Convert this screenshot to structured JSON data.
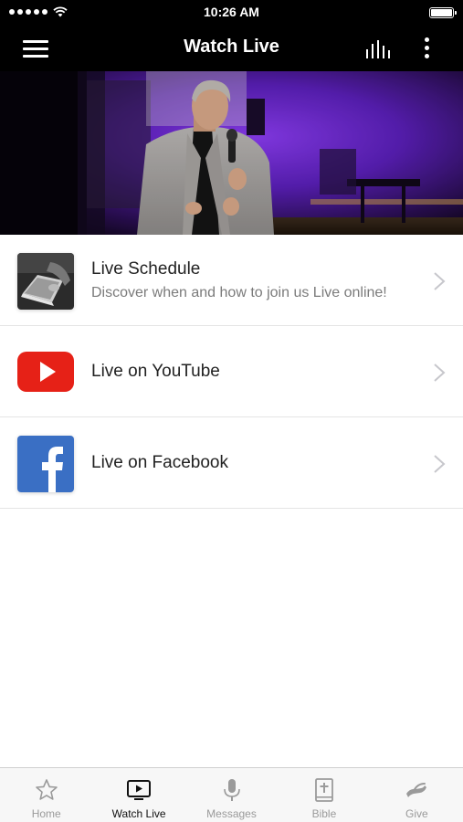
{
  "status_bar": {
    "time": "10:26 AM"
  },
  "nav": {
    "title": "Watch Live"
  },
  "hero": {
    "image": "speaker-on-stage-with-microphone-purple-lighting"
  },
  "list": {
    "items": [
      {
        "title": "Live Schedule",
        "subtitle": "Discover when and how to join us Live online!",
        "icon": "laptop-photo"
      },
      {
        "title": "Live on YouTube",
        "icon": "youtube-logo"
      },
      {
        "title": "Live on Facebook",
        "icon": "facebook-logo"
      }
    ]
  },
  "tabs": [
    {
      "label": "Home",
      "icon": "star-icon",
      "active": false
    },
    {
      "label": "Watch Live",
      "icon": "tv-play-icon",
      "active": true
    },
    {
      "label": "Messages",
      "icon": "microphone-icon",
      "active": false
    },
    {
      "label": "Bible",
      "icon": "bible-icon",
      "active": false
    },
    {
      "label": "Give",
      "icon": "giving-hand-icon",
      "active": false
    }
  ],
  "colors": {
    "accent_bar": "#000000",
    "youtube_red": "#e62117",
    "facebook_blue": "#3a6fc4",
    "tab_inactive": "#9a9a9a",
    "tab_active": "#111111"
  }
}
